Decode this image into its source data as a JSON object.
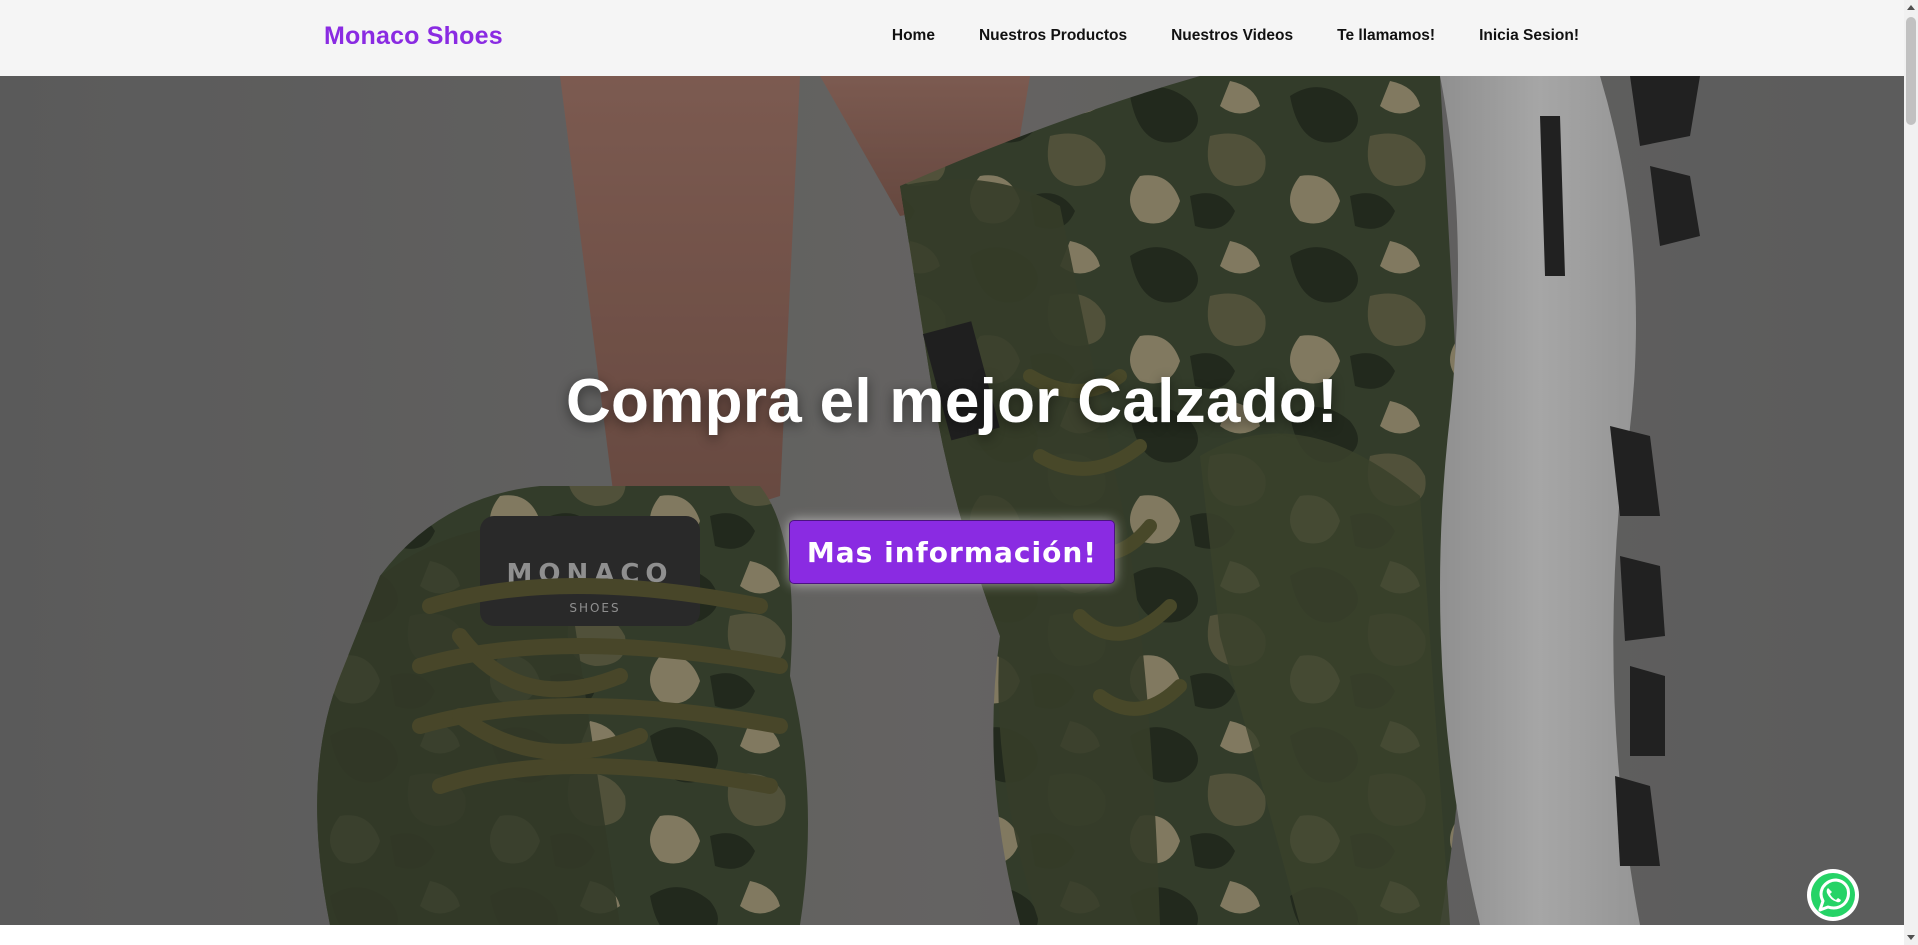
{
  "navbar": {
    "brand": "Monaco Shoes",
    "links": [
      "Home",
      "Nuestros Productos",
      "Nuestros Videos",
      "Te llamamos!",
      "Inicia Sesion!"
    ]
  },
  "hero": {
    "title": "Compra el mejor Calzado!",
    "button_label": "Mas información!",
    "image_logo_text": "MONACO",
    "image_logo_subtext": "SHOES"
  },
  "floating": {
    "whatsapp_icon": "whatsapp-icon"
  },
  "colors": {
    "brand": "#8a2be2",
    "navbar_bg": "#f5f5f5",
    "whatsapp_green": "#25d366"
  }
}
